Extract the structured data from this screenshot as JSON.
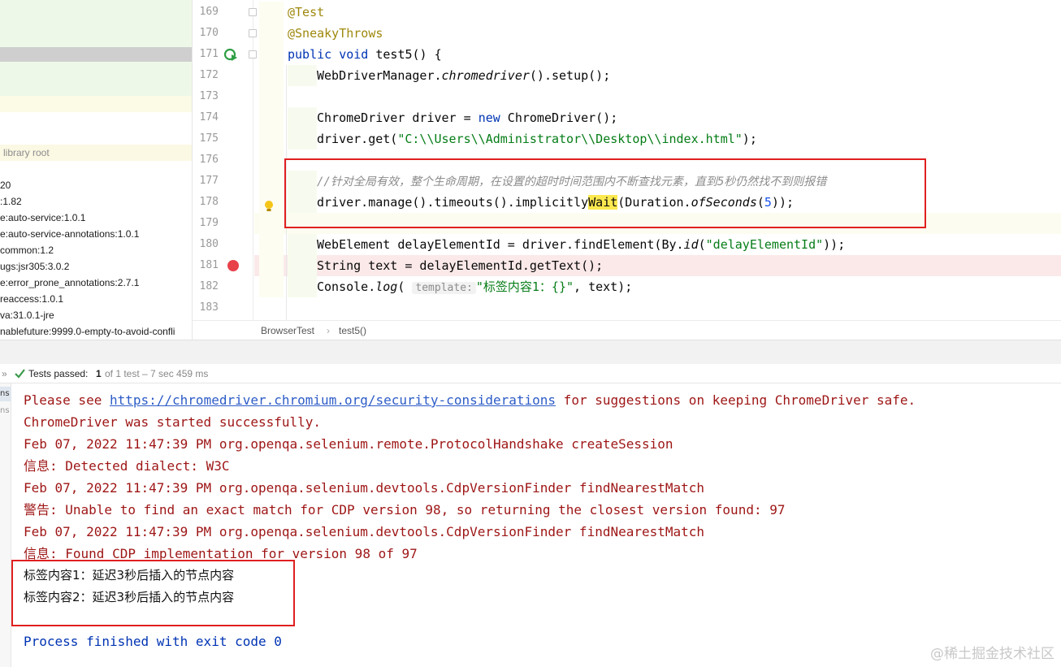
{
  "project_tree": {
    "library_root_label": "library root",
    "items": [
      "20",
      ":1.82",
      "e:auto-service:1.0.1",
      "e:auto-service-annotations:1.0.1",
      "common:1.2",
      "ugs:jsr305:3.0.2",
      "e:error_prone_annotations:2.7.1",
      "reaccess:1.0.1",
      "va:31.0.1-jre",
      "nablefuture:9999.0-empty-to-avoid-confli"
    ]
  },
  "editor": {
    "line_numbers": [
      "169",
      "170",
      "171",
      "172",
      "173",
      "174",
      "175",
      "176",
      "177",
      "178",
      "179",
      "180",
      "181",
      "182",
      "183"
    ],
    "lines": {
      "l169": "@Test",
      "l170": "@SneakyThrows",
      "l171_kw": "public void",
      "l171_rest": " test5() {",
      "l172_a": "WebDriverManager.",
      "l172_b": "chromedriver",
      "l172_c": "().setup();",
      "l174_a": "ChromeDriver driver = ",
      "l174_kw": "new",
      "l174_b": " ChromeDriver();",
      "l175_a": "driver.get(",
      "l175_str": "\"C:\\\\Users\\\\Administrator\\\\Desktop\\\\index.html\"",
      "l175_b": ");",
      "l177_cmt": "//针对全局有效，整个生命周期，在设置的超时时间范围内不断查找元素，直到5秒仍然找不到则报错",
      "l178_a": "driver.manage().timeouts().implicitly",
      "l178_hl": "Wait",
      "l178_b": "(Duration.",
      "l178_it": "ofSeconds",
      "l178_c": "(",
      "l178_num": "5",
      "l178_d": "));",
      "l180_a": "WebElement delayElementId = driver.findElement(By.",
      "l180_it": "id",
      "l180_b": "(",
      "l180_str": "\"delayElementId\"",
      "l180_c": "));",
      "l181": "String text = delayElementId.getText();",
      "l182_a": "Console.",
      "l182_it": "log",
      "l182_b": "( ",
      "l182_hint": "template:",
      "l182_str": "\"标签内容1：{}\"",
      "l182_c": ", text);"
    },
    "breadcrumb": [
      "BrowserTest",
      "test5()"
    ]
  },
  "run": {
    "status_prefix": "Tests passed:",
    "passed_count": "1",
    "status_suffix": "of 1 test – 7 sec 459 ms",
    "side_labels": [
      "ns",
      "ns"
    ]
  },
  "console": {
    "l1_a": "Please see ",
    "l1_link": "https://chromedriver.chromium.org/security-considerations",
    "l1_b": " for suggestions on keeping ChromeDriver safe.",
    "l2": "ChromeDriver was started successfully.",
    "l3": "Feb 07, 2022 11:47:39 PM org.openqa.selenium.remote.ProtocolHandshake createSession",
    "l4": "信息: Detected dialect: W3C",
    "l5": "Feb 07, 2022 11:47:39 PM org.openqa.selenium.devtools.CdpVersionFinder findNearestMatch",
    "l6": "警告: Unable to find an exact match for CDP version 98, so returning the closest version found: 97",
    "l7": "Feb 07, 2022 11:47:39 PM org.openqa.selenium.devtools.CdpVersionFinder findNearestMatch",
    "l8": "信息: Found CDP implementation for version 98 of 97",
    "l9": "标签内容1：延迟3秒后插入的节点内容",
    "l10": "标签内容2：延迟3秒后插入的节点内容",
    "l12": "Process finished with exit code 0"
  },
  "watermark": "@稀土掘金技术社区",
  "colors": {
    "accent_red": "#e02020",
    "keyword": "#0033b3",
    "string": "#067d17",
    "error": "#9e1515"
  }
}
